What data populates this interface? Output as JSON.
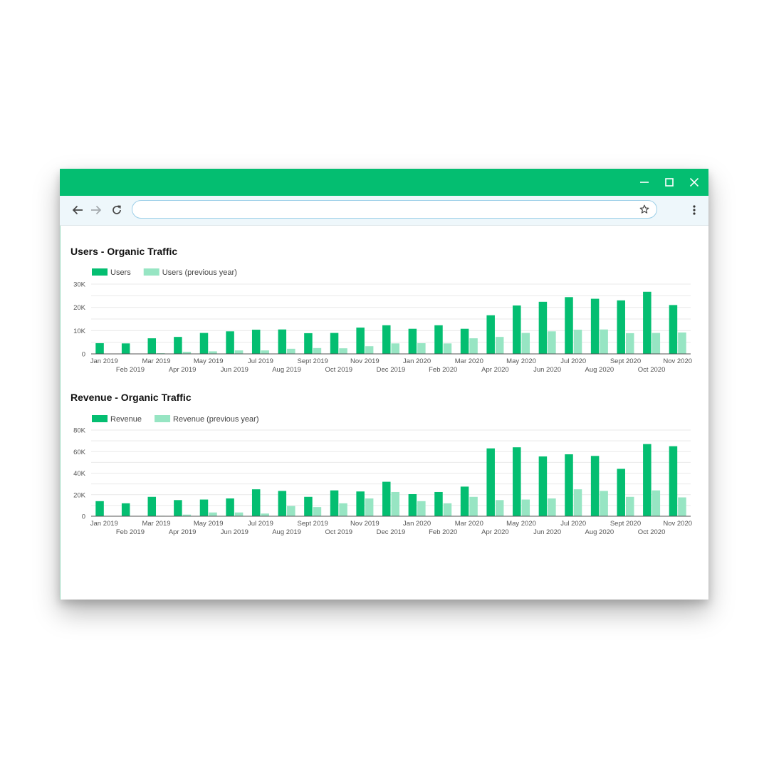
{
  "colors": {
    "brand": "#04be71",
    "current": "#04be71",
    "previous": "#97e5c3",
    "toolbar": "#eef7fb",
    "grid": "#e9e9e9"
  },
  "window": {
    "controls": {
      "minimize": "minimize-icon",
      "maximize": "maximize-icon",
      "close": "close-icon"
    }
  },
  "toolbar": {
    "back_icon": "arrow-left-icon",
    "forward_icon": "arrow-right-icon",
    "reload_icon": "reload-icon",
    "address_value": "",
    "address_placeholder": "",
    "bookmark_icon": "star-icon",
    "menu_icon": "more-vert-icon"
  },
  "chart_data": [
    {
      "type": "bar",
      "title": "Users - Organic Traffic",
      "xlabel": "",
      "ylabel": "",
      "categories": [
        "Jan 2019",
        "Feb 2019",
        "Mar 2019",
        "Apr 2019",
        "May 2019",
        "Jun 2019",
        "Jul 2019",
        "Aug 2019",
        "Sept 2019",
        "Oct 2019",
        "Nov 2019",
        "Dec 2019",
        "Jan 2020",
        "Feb 2020",
        "Mar 2020",
        "Apr 2020",
        "May 2020",
        "Jun 2020",
        "Jul 2020",
        "Aug 2020",
        "Sept 2020",
        "Oct 2020",
        "Nov 2020"
      ],
      "series": [
        {
          "name": "Users",
          "values": [
            4600,
            4500,
            6700,
            7300,
            9000,
            9700,
            10400,
            10500,
            8900,
            9000,
            11300,
            12300,
            10800,
            12300,
            10800,
            16600,
            20800,
            22400,
            24400,
            23700,
            23000,
            26700,
            21000
          ]
        },
        {
          "name": "Users (previous year)",
          "values": [
            0,
            0,
            300,
            900,
            1100,
            1500,
            1500,
            2200,
            2500,
            2400,
            3300,
            4500,
            4600,
            4500,
            6700,
            7300,
            9000,
            9700,
            10400,
            10500,
            8900,
            9000,
            9200
          ]
        }
      ],
      "yticks": [
        "0",
        "10K",
        "20K",
        "30K"
      ],
      "ylim": [
        0,
        30000
      ],
      "grid": true,
      "legend": "top-left"
    },
    {
      "type": "bar",
      "title": "Revenue - Organic Traffic",
      "xlabel": "",
      "ylabel": "",
      "categories": [
        "Jan 2019",
        "Feb 2019",
        "Mar 2019",
        "Apr 2019",
        "May 2019",
        "Jun 2019",
        "Jul 2019",
        "Aug 2019",
        "Sept 2019",
        "Oct 2019",
        "Nov 2019",
        "Dec 2019",
        "Jan 2020",
        "Feb 2020",
        "Mar 2020",
        "Apr 2020",
        "May 2020",
        "Jun 2020",
        "Jul 2020",
        "Aug 2020",
        "Sept 2020",
        "Oct 2020",
        "Nov 2020"
      ],
      "series": [
        {
          "name": "Revenue",
          "values": [
            14000,
            12000,
            18000,
            15000,
            15500,
            16500,
            25000,
            23500,
            18000,
            24000,
            23000,
            32000,
            20500,
            22500,
            27500,
            63000,
            64000,
            55500,
            57500,
            56000,
            44000,
            67000,
            65000
          ]
        },
        {
          "name": "Revenue (previous year)",
          "values": [
            0,
            0,
            400,
            1500,
            3500,
            3500,
            2500,
            9500,
            8500,
            12000,
            16500,
            22500,
            14000,
            12000,
            18000,
            15000,
            15500,
            16500,
            25000,
            23500,
            18000,
            24000,
            17500
          ]
        }
      ],
      "yticks": [
        "0",
        "20K",
        "40K",
        "60K",
        "80K"
      ],
      "ylim": [
        0,
        80000
      ],
      "grid": true,
      "legend": "top-left"
    }
  ]
}
